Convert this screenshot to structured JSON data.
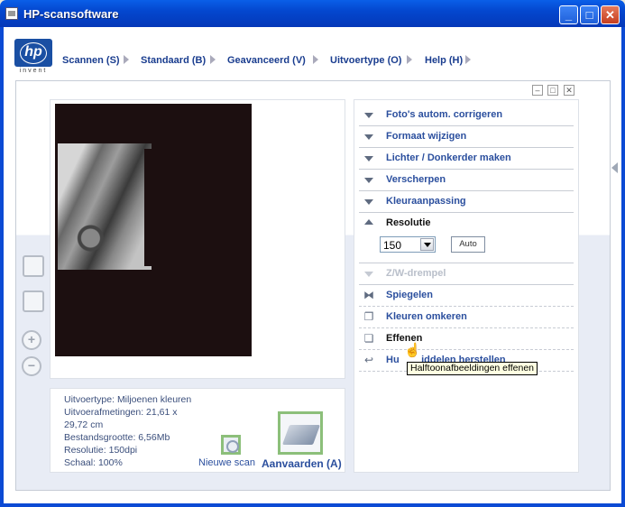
{
  "window": {
    "title": "HP-scansoftware",
    "buttons": {
      "minimize": "_",
      "maximize": "□",
      "close": "✕"
    }
  },
  "logo": {
    "mark": "hp",
    "tagline": "invent"
  },
  "menu": [
    {
      "label": "Scannen (S)"
    },
    {
      "label": "Standaard (B)"
    },
    {
      "label": "Geavanceerd (V)"
    },
    {
      "label": "Uitvoertype (O)"
    },
    {
      "label": "Help (H)"
    }
  ],
  "tools": {
    "auto_correct": "Foto's autom. corrigeren",
    "resize": "Formaat wijzigen",
    "lighter_darker": "Lichter / Donkerder maken",
    "sharpen": "Verscherpen",
    "color_adjust": "Kleuraanpassing",
    "resolution": "Resolutie",
    "resolution_value": "150",
    "auto_button": "Auto",
    "bw_threshold": "Z/W-drempel",
    "mirror": "Spiegelen",
    "invert_colors": "Kleuren omkeren",
    "smooth": "Effenen",
    "restore_defaults": "Huidige middelen herstellen",
    "restore_defaults_visible": "Hu        iddelen herstellen"
  },
  "tooltip": "Halftoonafbeeldingen effenen",
  "info": {
    "output_type": "Uitvoertype: Miljoenen kleuren",
    "output_size_1": "Uitvoerafmetingen: 21,61 x",
    "output_size_2": "29,72 cm",
    "file_size": "Bestandsgrootte: 6,56Mb",
    "resolution": "Resolutie:  150dpi",
    "scale": "Schaal: 100%"
  },
  "actions": {
    "new_scan": "Nieuwe scan",
    "accept": "Aanvaarden (A)"
  },
  "icons": {
    "title": "app-icon",
    "rotate_left": "rotate-left-icon",
    "rotate_right": "rotate-right-icon",
    "zoom_in": "zoom-in-icon",
    "zoom_out": "zoom-out-icon",
    "new_scan": "scanner-eye-icon",
    "accept": "scanner-icon"
  },
  "colors": {
    "title_bar": "#0447cf",
    "link": "#2b4f9e",
    "accent_green": "#8cbf7a"
  }
}
